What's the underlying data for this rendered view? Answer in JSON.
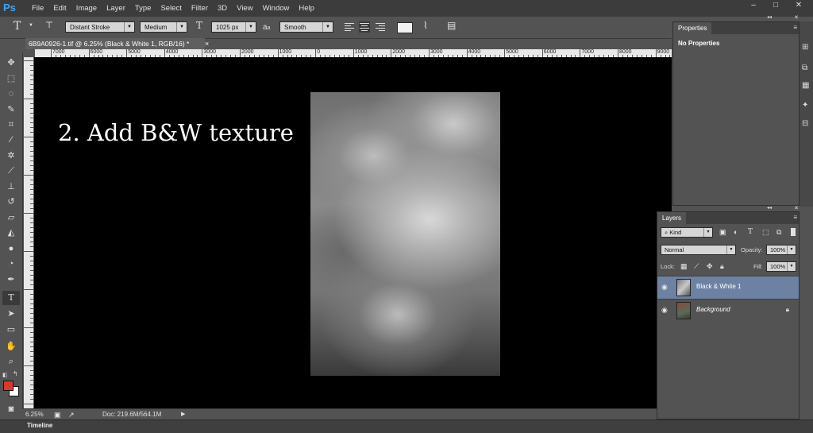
{
  "app": {
    "logo": "Ps"
  },
  "menu": [
    "File",
    "Edit",
    "Image",
    "Layer",
    "Type",
    "Select",
    "Filter",
    "3D",
    "View",
    "Window",
    "Help"
  ],
  "window_controls": {
    "minimize": "–",
    "maximize": "□",
    "close": "✕"
  },
  "options_bar": {
    "font_family": "Distant Stroke",
    "font_style": "Medium",
    "font_size": "1025 px",
    "antialias_label": "a",
    "antialias_value": "Smooth",
    "text_color": "#f2f2f2"
  },
  "document": {
    "tab_title": "6B9A0926-1.tif @ 6.25% (Black & White 1, RGB/16) *",
    "close": "×",
    "canvas_text": "2. Add B&W texture",
    "ruler_labels": [
      "7000",
      "6000",
      "5000",
      "4000",
      "3000",
      "2000",
      "1000",
      "0",
      "1000",
      "2000",
      "3000",
      "4000",
      "5000",
      "6000",
      "7000",
      "8000",
      "9000"
    ]
  },
  "status": {
    "zoom": "6.25%",
    "doc_info": "Doc: 219.6M/564.1M",
    "arrow": "▶"
  },
  "timeline": {
    "label": "Timeline"
  },
  "properties_panel": {
    "tab": "Properties",
    "content": "No Properties",
    "collapse": "◂◂",
    "close": "✕",
    "menu_icon": "≡"
  },
  "layers_panel": {
    "tab": "Layers",
    "collapse": "◂◂",
    "close": "✕",
    "menu_icon": "≡",
    "filter_kind": "Kind",
    "blend_mode": "Normal",
    "opacity_label": "Opacity:",
    "opacity_value": "100%",
    "lock_label": "Lock:",
    "fill_label": "Fill:",
    "fill_value": "100%",
    "layers": [
      {
        "name": "Black & White 1",
        "selected": true,
        "visible": true,
        "locked": false
      },
      {
        "name": "Background",
        "selected": false,
        "visible": true,
        "locked": true
      }
    ]
  },
  "colors": {
    "foreground": "#d8392b",
    "background": "#ffffff",
    "selection": "#6d82a3",
    "canvas": "#000000"
  }
}
